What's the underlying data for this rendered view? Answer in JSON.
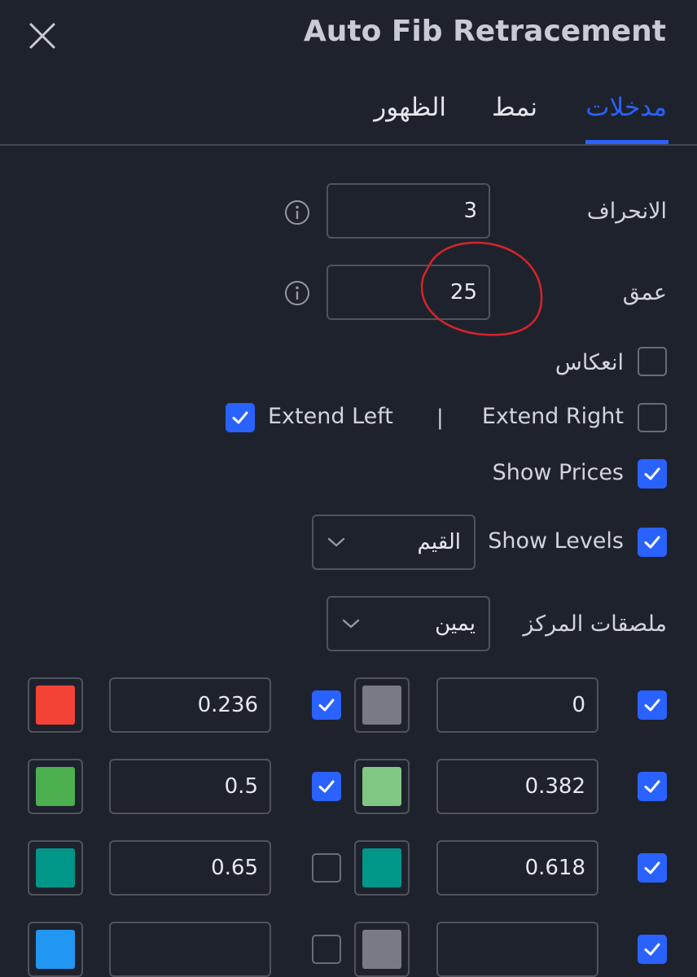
{
  "header": {
    "title": "Auto Fib Retracement"
  },
  "tabs": [
    {
      "label": "مدخلات",
      "active": true
    },
    {
      "label": "نمط",
      "active": false
    },
    {
      "label": "الظهور",
      "active": false
    }
  ],
  "inputs": {
    "deviation": {
      "label": "الانحراف",
      "value": "3"
    },
    "depth": {
      "label": "عمق",
      "value": "25"
    }
  },
  "options": {
    "reverse": {
      "label": "انعكاس",
      "checked": false
    },
    "extend_right": {
      "label": "Extend Right",
      "checked": false
    },
    "extend_left": {
      "label": "Extend Left",
      "checked": true
    },
    "separator": "|",
    "show_prices": {
      "label": "Show Prices",
      "checked": true
    },
    "show_levels": {
      "label": "Show Levels",
      "checked": true,
      "selected": "القيم"
    },
    "labels_position": {
      "label": "ملصقات المركز",
      "selected": "يمين"
    }
  },
  "levels": [
    {
      "value": "0",
      "checked": true,
      "color": "#787b86"
    },
    {
      "value": "0.236",
      "checked": true,
      "color": "#f44336"
    },
    {
      "value": "0.382",
      "checked": true,
      "color": "#81c784"
    },
    {
      "value": "0.5",
      "checked": true,
      "color": "#4caf50"
    },
    {
      "value": "0.618",
      "checked": true,
      "color": "#009688"
    },
    {
      "value": "0.65",
      "checked": false,
      "color": "#009688"
    },
    {
      "value": "",
      "checked": true,
      "color": "#787b86"
    },
    {
      "value": "",
      "checked": false,
      "color": "#2196f3"
    }
  ],
  "colors": {
    "background": "#1e222d",
    "accent": "#2962ff",
    "border": "#50535e",
    "annotation": "#d5242a"
  }
}
